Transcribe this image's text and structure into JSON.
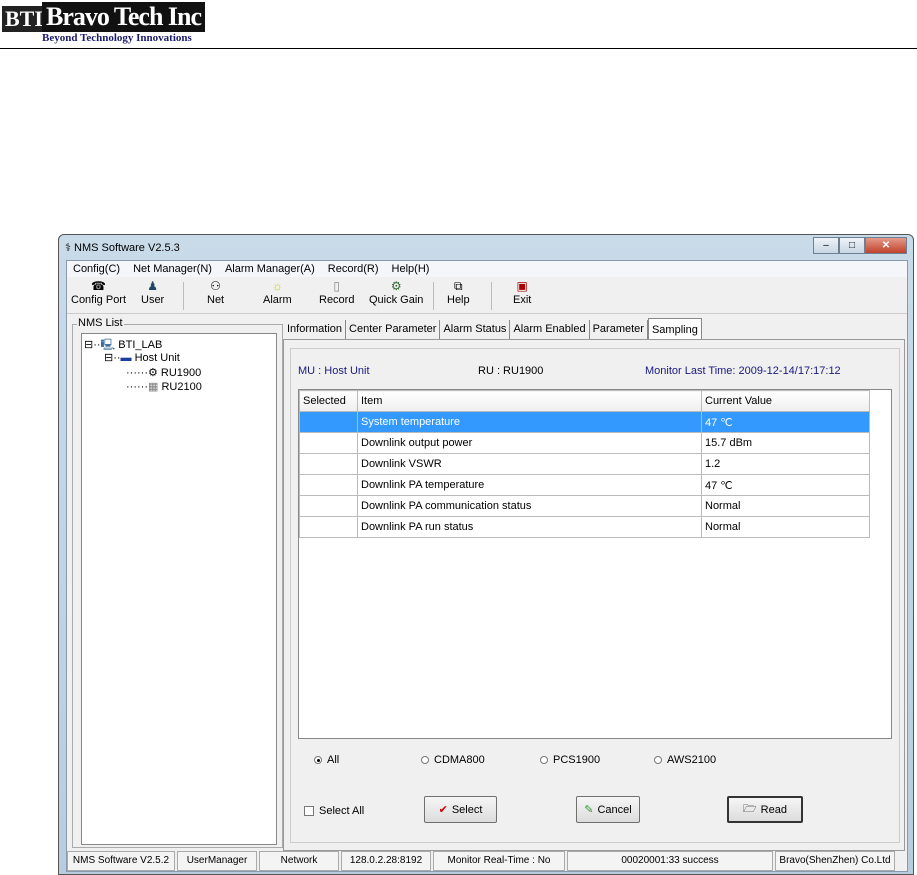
{
  "doc": {
    "logo_mark": "BTI",
    "logo_name": "Bravo Tech Inc",
    "logo_tagline": "Beyond Technology Innovations"
  },
  "window": {
    "title": "NMS Software V2.5.3"
  },
  "menu": [
    "Config(C)",
    "Net Manager(N)",
    "Alarm Manager(A)",
    "Record(R)",
    "Help(H)"
  ],
  "toolbar": [
    {
      "label": "Config Port",
      "icon": "config-port-icon"
    },
    {
      "label": "User",
      "icon": "user-icon"
    },
    {
      "label": "Net",
      "icon": "net-icon"
    },
    {
      "label": "Alarm",
      "icon": "alarm-icon"
    },
    {
      "label": "Record",
      "icon": "record-icon"
    },
    {
      "label": "Quick Gain",
      "icon": "quick-gain-icon"
    },
    {
      "label": "Help",
      "icon": "help-icon"
    },
    {
      "label": "Exit",
      "icon": "exit-icon"
    }
  ],
  "nms_list": {
    "title": "NMS List",
    "root": "BTI_LAB",
    "host": "Host Unit",
    "children": [
      "RU1900",
      "RU2100"
    ]
  },
  "tabs": [
    "Information",
    "Center Parameter",
    "Alarm Status",
    "Alarm Enabled",
    "Parameter",
    "Sampling"
  ],
  "sampling": {
    "mu": "MU : Host Unit",
    "ru": "RU : RU1900",
    "monitor_time": "Monitor Last Time: 2009-12-14/17:17:12",
    "columns": [
      "Selected",
      "Item",
      "Current Value"
    ],
    "rows": [
      {
        "selected": "",
        "item": "System temperature",
        "value": "47 ℃"
      },
      {
        "selected": "",
        "item": "Downlink output power",
        "value": "15.7 dBm"
      },
      {
        "selected": "",
        "item": "Downlink VSWR",
        "value": "1.2"
      },
      {
        "selected": "",
        "item": "Downlink PA temperature",
        "value": "47 ℃"
      },
      {
        "selected": "",
        "item": "Downlink PA communication status",
        "value": "Normal"
      },
      {
        "selected": "",
        "item": "Downlink PA run status",
        "value": "Normal"
      }
    ],
    "filters": [
      "All",
      "CDMA800",
      "PCS1900",
      "AWS2100"
    ],
    "select_all": "Select All",
    "select": "Select",
    "cancel": "Cancel",
    "read": "Read"
  },
  "status": [
    "NMS Software V2.5.2",
    "UserManager",
    "Network",
    "128.0.2.28:8192",
    "Monitor Real-Time : No",
    "00020001:33 success",
    "Bravo(ShenZhen) Co.Ltd"
  ],
  "colors": {
    "selection": "#3399ff",
    "header_text": "#1a1a80"
  }
}
